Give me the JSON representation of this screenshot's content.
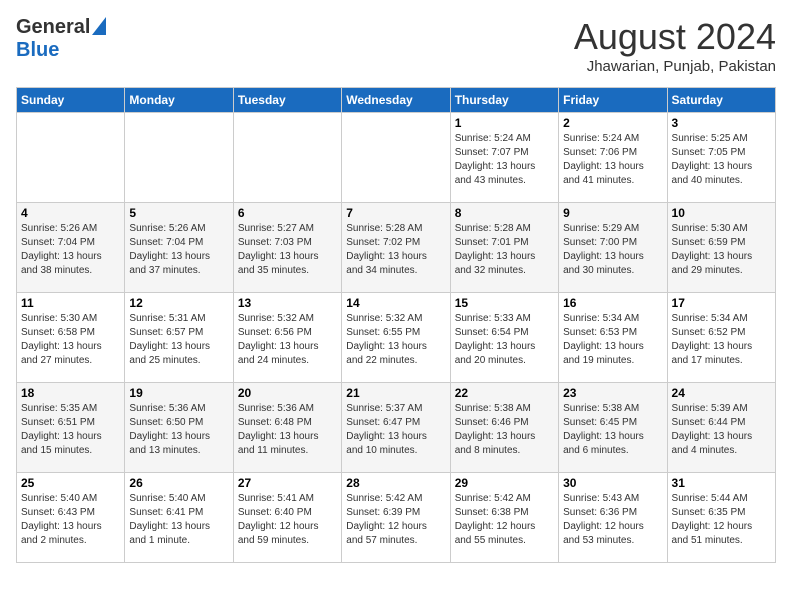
{
  "header": {
    "logo_general": "General",
    "logo_blue": "Blue",
    "month_year": "August 2024",
    "location": "Jhawarian, Punjab, Pakistan"
  },
  "days_of_week": [
    "Sunday",
    "Monday",
    "Tuesday",
    "Wednesday",
    "Thursday",
    "Friday",
    "Saturday"
  ],
  "weeks": [
    [
      {
        "day": "",
        "info": ""
      },
      {
        "day": "",
        "info": ""
      },
      {
        "day": "",
        "info": ""
      },
      {
        "day": "",
        "info": ""
      },
      {
        "day": "1",
        "info": "Sunrise: 5:24 AM\nSunset: 7:07 PM\nDaylight: 13 hours\nand 43 minutes."
      },
      {
        "day": "2",
        "info": "Sunrise: 5:24 AM\nSunset: 7:06 PM\nDaylight: 13 hours\nand 41 minutes."
      },
      {
        "day": "3",
        "info": "Sunrise: 5:25 AM\nSunset: 7:05 PM\nDaylight: 13 hours\nand 40 minutes."
      }
    ],
    [
      {
        "day": "4",
        "info": "Sunrise: 5:26 AM\nSunset: 7:04 PM\nDaylight: 13 hours\nand 38 minutes."
      },
      {
        "day": "5",
        "info": "Sunrise: 5:26 AM\nSunset: 7:04 PM\nDaylight: 13 hours\nand 37 minutes."
      },
      {
        "day": "6",
        "info": "Sunrise: 5:27 AM\nSunset: 7:03 PM\nDaylight: 13 hours\nand 35 minutes."
      },
      {
        "day": "7",
        "info": "Sunrise: 5:28 AM\nSunset: 7:02 PM\nDaylight: 13 hours\nand 34 minutes."
      },
      {
        "day": "8",
        "info": "Sunrise: 5:28 AM\nSunset: 7:01 PM\nDaylight: 13 hours\nand 32 minutes."
      },
      {
        "day": "9",
        "info": "Sunrise: 5:29 AM\nSunset: 7:00 PM\nDaylight: 13 hours\nand 30 minutes."
      },
      {
        "day": "10",
        "info": "Sunrise: 5:30 AM\nSunset: 6:59 PM\nDaylight: 13 hours\nand 29 minutes."
      }
    ],
    [
      {
        "day": "11",
        "info": "Sunrise: 5:30 AM\nSunset: 6:58 PM\nDaylight: 13 hours\nand 27 minutes."
      },
      {
        "day": "12",
        "info": "Sunrise: 5:31 AM\nSunset: 6:57 PM\nDaylight: 13 hours\nand 25 minutes."
      },
      {
        "day": "13",
        "info": "Sunrise: 5:32 AM\nSunset: 6:56 PM\nDaylight: 13 hours\nand 24 minutes."
      },
      {
        "day": "14",
        "info": "Sunrise: 5:32 AM\nSunset: 6:55 PM\nDaylight: 13 hours\nand 22 minutes."
      },
      {
        "day": "15",
        "info": "Sunrise: 5:33 AM\nSunset: 6:54 PM\nDaylight: 13 hours\nand 20 minutes."
      },
      {
        "day": "16",
        "info": "Sunrise: 5:34 AM\nSunset: 6:53 PM\nDaylight: 13 hours\nand 19 minutes."
      },
      {
        "day": "17",
        "info": "Sunrise: 5:34 AM\nSunset: 6:52 PM\nDaylight: 13 hours\nand 17 minutes."
      }
    ],
    [
      {
        "day": "18",
        "info": "Sunrise: 5:35 AM\nSunset: 6:51 PM\nDaylight: 13 hours\nand 15 minutes."
      },
      {
        "day": "19",
        "info": "Sunrise: 5:36 AM\nSunset: 6:50 PM\nDaylight: 13 hours\nand 13 minutes."
      },
      {
        "day": "20",
        "info": "Sunrise: 5:36 AM\nSunset: 6:48 PM\nDaylight: 13 hours\nand 11 minutes."
      },
      {
        "day": "21",
        "info": "Sunrise: 5:37 AM\nSunset: 6:47 PM\nDaylight: 13 hours\nand 10 minutes."
      },
      {
        "day": "22",
        "info": "Sunrise: 5:38 AM\nSunset: 6:46 PM\nDaylight: 13 hours\nand 8 minutes."
      },
      {
        "day": "23",
        "info": "Sunrise: 5:38 AM\nSunset: 6:45 PM\nDaylight: 13 hours\nand 6 minutes."
      },
      {
        "day": "24",
        "info": "Sunrise: 5:39 AM\nSunset: 6:44 PM\nDaylight: 13 hours\nand 4 minutes."
      }
    ],
    [
      {
        "day": "25",
        "info": "Sunrise: 5:40 AM\nSunset: 6:43 PM\nDaylight: 13 hours\nand 2 minutes."
      },
      {
        "day": "26",
        "info": "Sunrise: 5:40 AM\nSunset: 6:41 PM\nDaylight: 13 hours\nand 1 minute."
      },
      {
        "day": "27",
        "info": "Sunrise: 5:41 AM\nSunset: 6:40 PM\nDaylight: 12 hours\nand 59 minutes."
      },
      {
        "day": "28",
        "info": "Sunrise: 5:42 AM\nSunset: 6:39 PM\nDaylight: 12 hours\nand 57 minutes."
      },
      {
        "day": "29",
        "info": "Sunrise: 5:42 AM\nSunset: 6:38 PM\nDaylight: 12 hours\nand 55 minutes."
      },
      {
        "day": "30",
        "info": "Sunrise: 5:43 AM\nSunset: 6:36 PM\nDaylight: 12 hours\nand 53 minutes."
      },
      {
        "day": "31",
        "info": "Sunrise: 5:44 AM\nSunset: 6:35 PM\nDaylight: 12 hours\nand 51 minutes."
      }
    ]
  ]
}
